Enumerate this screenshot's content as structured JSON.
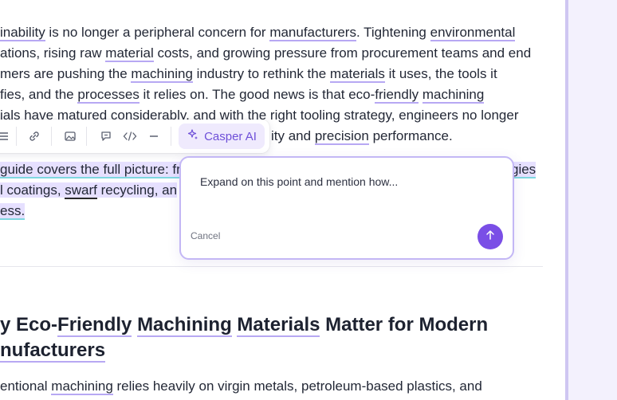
{
  "document": {
    "para1": {
      "l1": {
        "t1": "inability",
        "t2": " is no longer a peripheral concern for ",
        "t3": "manufacturers",
        "t4": ". Tightening ",
        "t5": "environmental"
      },
      "l2": {
        "t1": "ations, rising raw ",
        "t2": "material",
        "t3": " costs, and growing pressure from procurement teams and end"
      },
      "l3": {
        "t1": "mers are pushing the ",
        "t2": "machining",
        "t3": " industry to rethink the ",
        "t4": "materials",
        "t5": " it uses, the tools it"
      },
      "l4": {
        "t1": "fies, and the ",
        "t2": "processes",
        "t3": " it relies on. The good news is that eco-",
        "t4": "friendly",
        "t5": " ",
        "t6": "machining"
      },
      "l5": "ials have matured considerably, and with the right tooling strategy, engineers no longer",
      "l6": {
        "t1": "ity and ",
        "t2": "precision",
        "t3": " performance."
      }
    },
    "para2": {
      "l1a": "guide covers the full picture: fr",
      "l1b": "gies",
      "l2a": "l coatings, ",
      "l2b": "swarf",
      "l2c": " recycling, an",
      "l3": "ess."
    },
    "heading": {
      "l1": {
        "t1": "y Eco-",
        "t2": "Friendly",
        "t3": " ",
        "t4": "Machining",
        "t5": " ",
        "t6": "Materials",
        "t7": " Matter for Modern"
      },
      "l2": "nufacturers"
    },
    "para3": {
      "t1": "entional ",
      "t2": "machining",
      "t3": " relies heavily on virgin metals, petroleum-based plastics, and"
    }
  },
  "toolbar": {
    "casper_label": "Casper AI",
    "icons": [
      "list-icon",
      "link-icon",
      "image-icon",
      "comment-icon",
      "code-icon",
      "horizontal-rule-icon",
      "sparkle-icon"
    ]
  },
  "ai_prompt": {
    "text": "Expand on this point and mention how...",
    "cancel_label": "Cancel",
    "send_icon": "arrow-up-icon"
  },
  "colors": {
    "accent": "#7a4ee6",
    "selection": "#e6e0ff",
    "underline": "#b7a8f3",
    "side_panel": "#f3f1fd"
  }
}
